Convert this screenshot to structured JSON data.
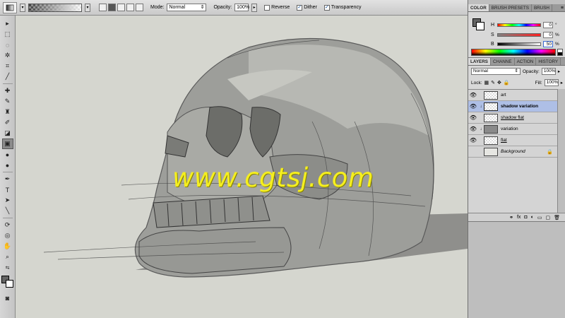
{
  "options_bar": {
    "mode_label": "Mode:",
    "mode_value": "Normal",
    "opacity_label": "Opacity:",
    "opacity_value": "100%",
    "reverse_label": "Reverse",
    "dither_label": "Dither",
    "transparency_label": "Transparency"
  },
  "watermark": "www.cgtsj.com",
  "color_panel": {
    "tabs": [
      "COLOR",
      "BRUSH PRESETS",
      "BRUSH"
    ],
    "h_label": "H",
    "h_value": "0",
    "s_label": "S",
    "s_value": "0",
    "b_label": "B",
    "b_value": "50",
    "pct": "%",
    "deg": "°"
  },
  "layers_panel": {
    "tabs": [
      "LAYERS",
      "CHANNE",
      "ACTION",
      "HISTORY"
    ],
    "blend_mode": "Normal",
    "opacity_label": "Opacity:",
    "opacity_value": "100%",
    "lock_label": "Lock:",
    "fill_label": "Fill:",
    "fill_value": "100%",
    "layers": [
      {
        "name": "art"
      },
      {
        "name": "shadow variation"
      },
      {
        "name": "shadow flat"
      },
      {
        "name": "variation"
      },
      {
        "name": "flat"
      },
      {
        "name": "Background"
      }
    ]
  },
  "colors": {
    "foreground": "#646464",
    "background": "#ffffff",
    "selected_layer": "#aebfe6",
    "watermark": "#f5ef1f",
    "canvas": "#d5d6cf"
  }
}
